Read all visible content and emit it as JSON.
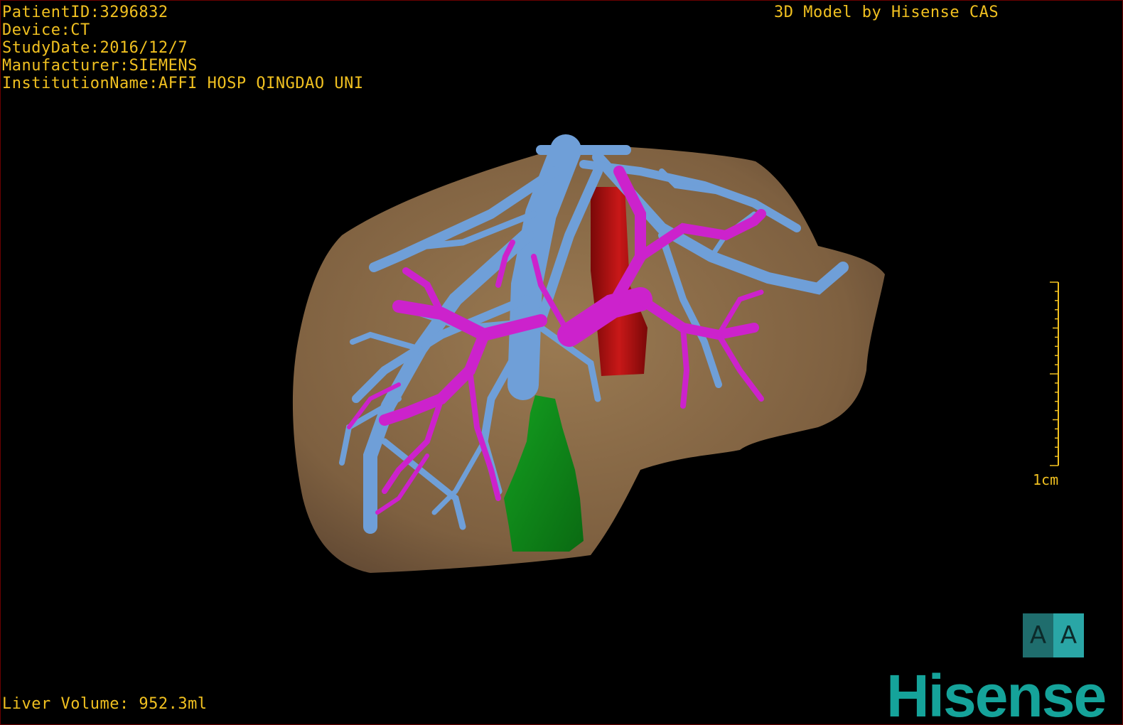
{
  "patient_info": {
    "patient_id": "PatientID:3296832",
    "device": "Device:CT",
    "study_date": "StudyDate:2016/12/7",
    "manufacturer": "Manufacturer:SIEMENS",
    "institution": "InstitutionName:AFFI HOSP QINGDAO UNI"
  },
  "model_credit": "3D Model by Hisense CAS",
  "liver_volume": "Liver Volume: 952.3ml",
  "scale_bar": {
    "label": "1cm"
  },
  "orientation": {
    "left": "A",
    "right": "A"
  },
  "brand": "Hisense",
  "colors": {
    "text": "#f0c020",
    "liver": "#8a6a43",
    "hepatic_vein": "#6f9fd8",
    "portal_vein": "#cc22cc",
    "ivc": "#b01010",
    "gallbladder": "#0f8a1a",
    "brand": "#15a39a"
  }
}
